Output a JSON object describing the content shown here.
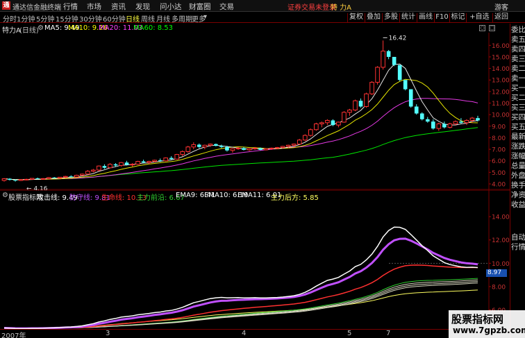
{
  "titlebar": {
    "logo_char": "通",
    "title": "通达信金融终端",
    "menus": [
      "行情",
      "市场",
      "资讯",
      "发现",
      "问小达",
      "财富圈",
      "交易"
    ],
    "notice": "证券交易未登录",
    "notice_stock": "特 力A",
    "user": "游客"
  },
  "toolbar": {
    "periods": [
      "分时",
      "1分钟",
      "5分钟",
      "15分钟",
      "30分钟",
      "60分钟",
      "日线",
      "周线",
      "月线",
      "多周期",
      "更多"
    ],
    "active_period": "日线",
    "right_buttons": [
      "复权",
      "叠加",
      "多股",
      "统计",
      "画线",
      "F10",
      "标记",
      "+自选",
      "返回"
    ]
  },
  "info": {
    "stock": "特力A",
    "period": "(日线)",
    "ma5": "MA5: 9.49",
    "ma10": "MA10: 9.26",
    "ma20": "MA20: 11.03",
    "ma60": "MA60: 8.53",
    "colors": {
      "ma5": "#ffffff",
      "ma10": "#ffff00",
      "ma20": "#ff40ff",
      "ma60": "#00ff00"
    }
  },
  "main_chart": {
    "high_label": "16.42",
    "low_label": "4.16",
    "y_ticks": [
      "16.00",
      "15.00",
      "14.00",
      "13.00",
      "12.00",
      "11.00",
      "10.00",
      "9.00",
      "8.00",
      "7.00",
      "6.00",
      "5.00",
      "4.00"
    ],
    "candles": [
      [
        4.3,
        4.5,
        4.2,
        4.45
      ],
      [
        4.45,
        4.5,
        4.3,
        4.35
      ],
      [
        4.35,
        4.4,
        4.2,
        4.3
      ],
      [
        4.3,
        4.4,
        4.25,
        4.38
      ],
      [
        4.38,
        4.45,
        4.3,
        4.4
      ],
      [
        4.4,
        4.5,
        4.35,
        4.48
      ],
      [
        4.48,
        4.55,
        4.4,
        4.42
      ],
      [
        4.42,
        4.5,
        4.38,
        4.46
      ],
      [
        4.46,
        4.6,
        4.42,
        4.55
      ],
      [
        4.55,
        4.6,
        4.45,
        4.5
      ],
      [
        4.5,
        4.6,
        4.45,
        4.58
      ],
      [
        4.58,
        4.7,
        4.5,
        4.65
      ],
      [
        4.65,
        4.75,
        4.55,
        4.6
      ],
      [
        4.6,
        4.8,
        4.55,
        4.75
      ],
      [
        4.75,
        4.9,
        4.7,
        4.85
      ],
      [
        4.85,
        5.2,
        4.8,
        5.1
      ],
      [
        5.1,
        5.3,
        5.0,
        5.2
      ],
      [
        5.2,
        5.6,
        5.1,
        5.55
      ],
      [
        5.55,
        5.7,
        5.3,
        5.4
      ],
      [
        5.4,
        5.8,
        5.35,
        5.7
      ],
      [
        5.7,
        5.8,
        5.5,
        5.6
      ],
      [
        5.6,
        5.9,
        5.5,
        5.85
      ],
      [
        5.85,
        6.0,
        5.6,
        5.65
      ],
      [
        5.65,
        5.8,
        5.5,
        5.7
      ],
      [
        5.7,
        6.0,
        5.65,
        5.95
      ],
      [
        5.95,
        6.1,
        5.8,
        5.85
      ],
      [
        5.85,
        6.0,
        5.7,
        5.95
      ],
      [
        5.95,
        6.1,
        5.85,
        6.05
      ],
      [
        6.05,
        6.2,
        5.9,
        6.0
      ],
      [
        6.0,
        6.3,
        5.95,
        6.25
      ],
      [
        6.25,
        6.4,
        6.1,
        6.15
      ],
      [
        6.15,
        6.6,
        6.1,
        6.55
      ],
      [
        6.55,
        6.9,
        6.4,
        6.8
      ],
      [
        6.8,
        7.3,
        6.7,
        7.2
      ],
      [
        7.2,
        7.6,
        7.0,
        7.4
      ],
      [
        7.4,
        7.5,
        7.1,
        7.2
      ],
      [
        7.2,
        7.4,
        7.0,
        7.35
      ],
      [
        7.35,
        7.5,
        7.2,
        7.45
      ],
      [
        7.45,
        7.5,
        7.25,
        7.3
      ],
      [
        7.3,
        7.4,
        7.1,
        7.2
      ],
      [
        7.2,
        7.3,
        6.8,
        6.9
      ],
      [
        6.9,
        7.1,
        6.7,
        7.05
      ],
      [
        7.05,
        7.2,
        6.95,
        7.1
      ],
      [
        7.1,
        7.2,
        6.9,
        6.95
      ],
      [
        6.95,
        7.1,
        6.85,
        7.05
      ],
      [
        7.05,
        7.2,
        6.95,
        7.1
      ],
      [
        7.1,
        7.15,
        6.9,
        6.95
      ],
      [
        6.95,
        7.1,
        6.9,
        7.05
      ],
      [
        7.05,
        7.15,
        6.95,
        7.1
      ],
      [
        7.1,
        7.2,
        7.0,
        7.15
      ],
      [
        7.15,
        7.3,
        7.05,
        7.25
      ],
      [
        7.25,
        7.4,
        7.1,
        7.35
      ],
      [
        7.35,
        7.5,
        7.2,
        7.45
      ],
      [
        7.45,
        7.9,
        7.4,
        7.8
      ],
      [
        7.8,
        8.3,
        7.7,
        8.2
      ],
      [
        8.2,
        8.8,
        8.1,
        8.7
      ],
      [
        8.7,
        9.3,
        8.6,
        9.2
      ],
      [
        9.2,
        9.4,
        8.9,
        9.3
      ],
      [
        9.3,
        9.6,
        9.1,
        9.5
      ],
      [
        9.5,
        9.6,
        9.0,
        9.1
      ],
      [
        9.1,
        9.4,
        8.9,
        9.35
      ],
      [
        9.35,
        10.3,
        9.3,
        10.2
      ],
      [
        10.2,
        10.5,
        9.9,
        10.4
      ],
      [
        10.4,
        11.3,
        10.3,
        11.2
      ],
      [
        11.2,
        11.4,
        10.6,
        10.7
      ],
      [
        10.7,
        11.9,
        10.6,
        11.8
      ],
      [
        11.8,
        12.9,
        11.7,
        12.8
      ],
      [
        12.8,
        14.2,
        12.6,
        14.1
      ],
      [
        14.1,
        16.42,
        13.9,
        15.5
      ],
      [
        15.5,
        15.6,
        14.8,
        15.0
      ],
      [
        15.0,
        14.9,
        14.2,
        14.3
      ],
      [
        14.3,
        13.6,
        12.9,
        13.0
      ],
      [
        13.0,
        12.9,
        12.1,
        12.2
      ],
      [
        12.2,
        11.8,
        10.6,
        10.7
      ],
      [
        10.7,
        10.9,
        10.0,
        10.1
      ],
      [
        10.1,
        10.2,
        9.5,
        9.6
      ],
      [
        9.6,
        9.8,
        9.3,
        9.4
      ],
      [
        9.4,
        9.6,
        8.7,
        8.8
      ],
      [
        8.8,
        9.3,
        8.6,
        9.2
      ],
      [
        9.2,
        9.4,
        8.8,
        8.9
      ],
      [
        8.9,
        9.3,
        8.8,
        9.2
      ],
      [
        9.2,
        9.5,
        9.1,
        9.4
      ],
      [
        9.4,
        9.7,
        9.2,
        9.3
      ],
      [
        9.3,
        9.6,
        9.1,
        9.5
      ],
      [
        9.5,
        9.8,
        9.3,
        9.7
      ],
      [
        9.7,
        9.9,
        9.4,
        9.5
      ]
    ]
  },
  "sub_indicator": {
    "title": "股票指标网",
    "lines": [
      {
        "text": "攻击线: 9.49",
        "color": "#ffffff"
      },
      {
        "text": "防守线: 9.81",
        "color": "#c050ff"
      },
      {
        "text": "生命线: 10.13",
        "color": "#ff3030"
      },
      {
        "text": "主力前沿: 6.67",
        "color": "#30d030"
      },
      {
        "text": "EMA9: 6.41",
        "color": "#ffffff"
      },
      {
        "text": "EMA10: 6.19",
        "color": "#ffffff"
      },
      {
        "text": "EMA11: 6.01",
        "color": "#ffffff"
      },
      {
        "text": "主力后方: 5.85",
        "color": "#ffff60"
      }
    ],
    "y_ticks": [
      "14.00",
      "12.00",
      "10.00",
      "8.00",
      "6.00"
    ],
    "value_tag": "8.97"
  },
  "date_axis": [
    "2007年",
    "3",
    "4",
    "5",
    "7"
  ],
  "right_panel": [
    "委比",
    "卖五",
    "卖四",
    "卖三",
    "卖二",
    "卖一",
    "买一",
    "买二",
    "买三",
    "买四",
    "买五",
    "最新",
    "涨跌",
    "涨幅",
    "总量",
    "外盘",
    "换手",
    "净资",
    "收益",
    "",
    "",
    "",
    "自动",
    "行情"
  ],
  "watermark": {
    "main": "股票指标网",
    "url": "www.7gpzb.com"
  }
}
